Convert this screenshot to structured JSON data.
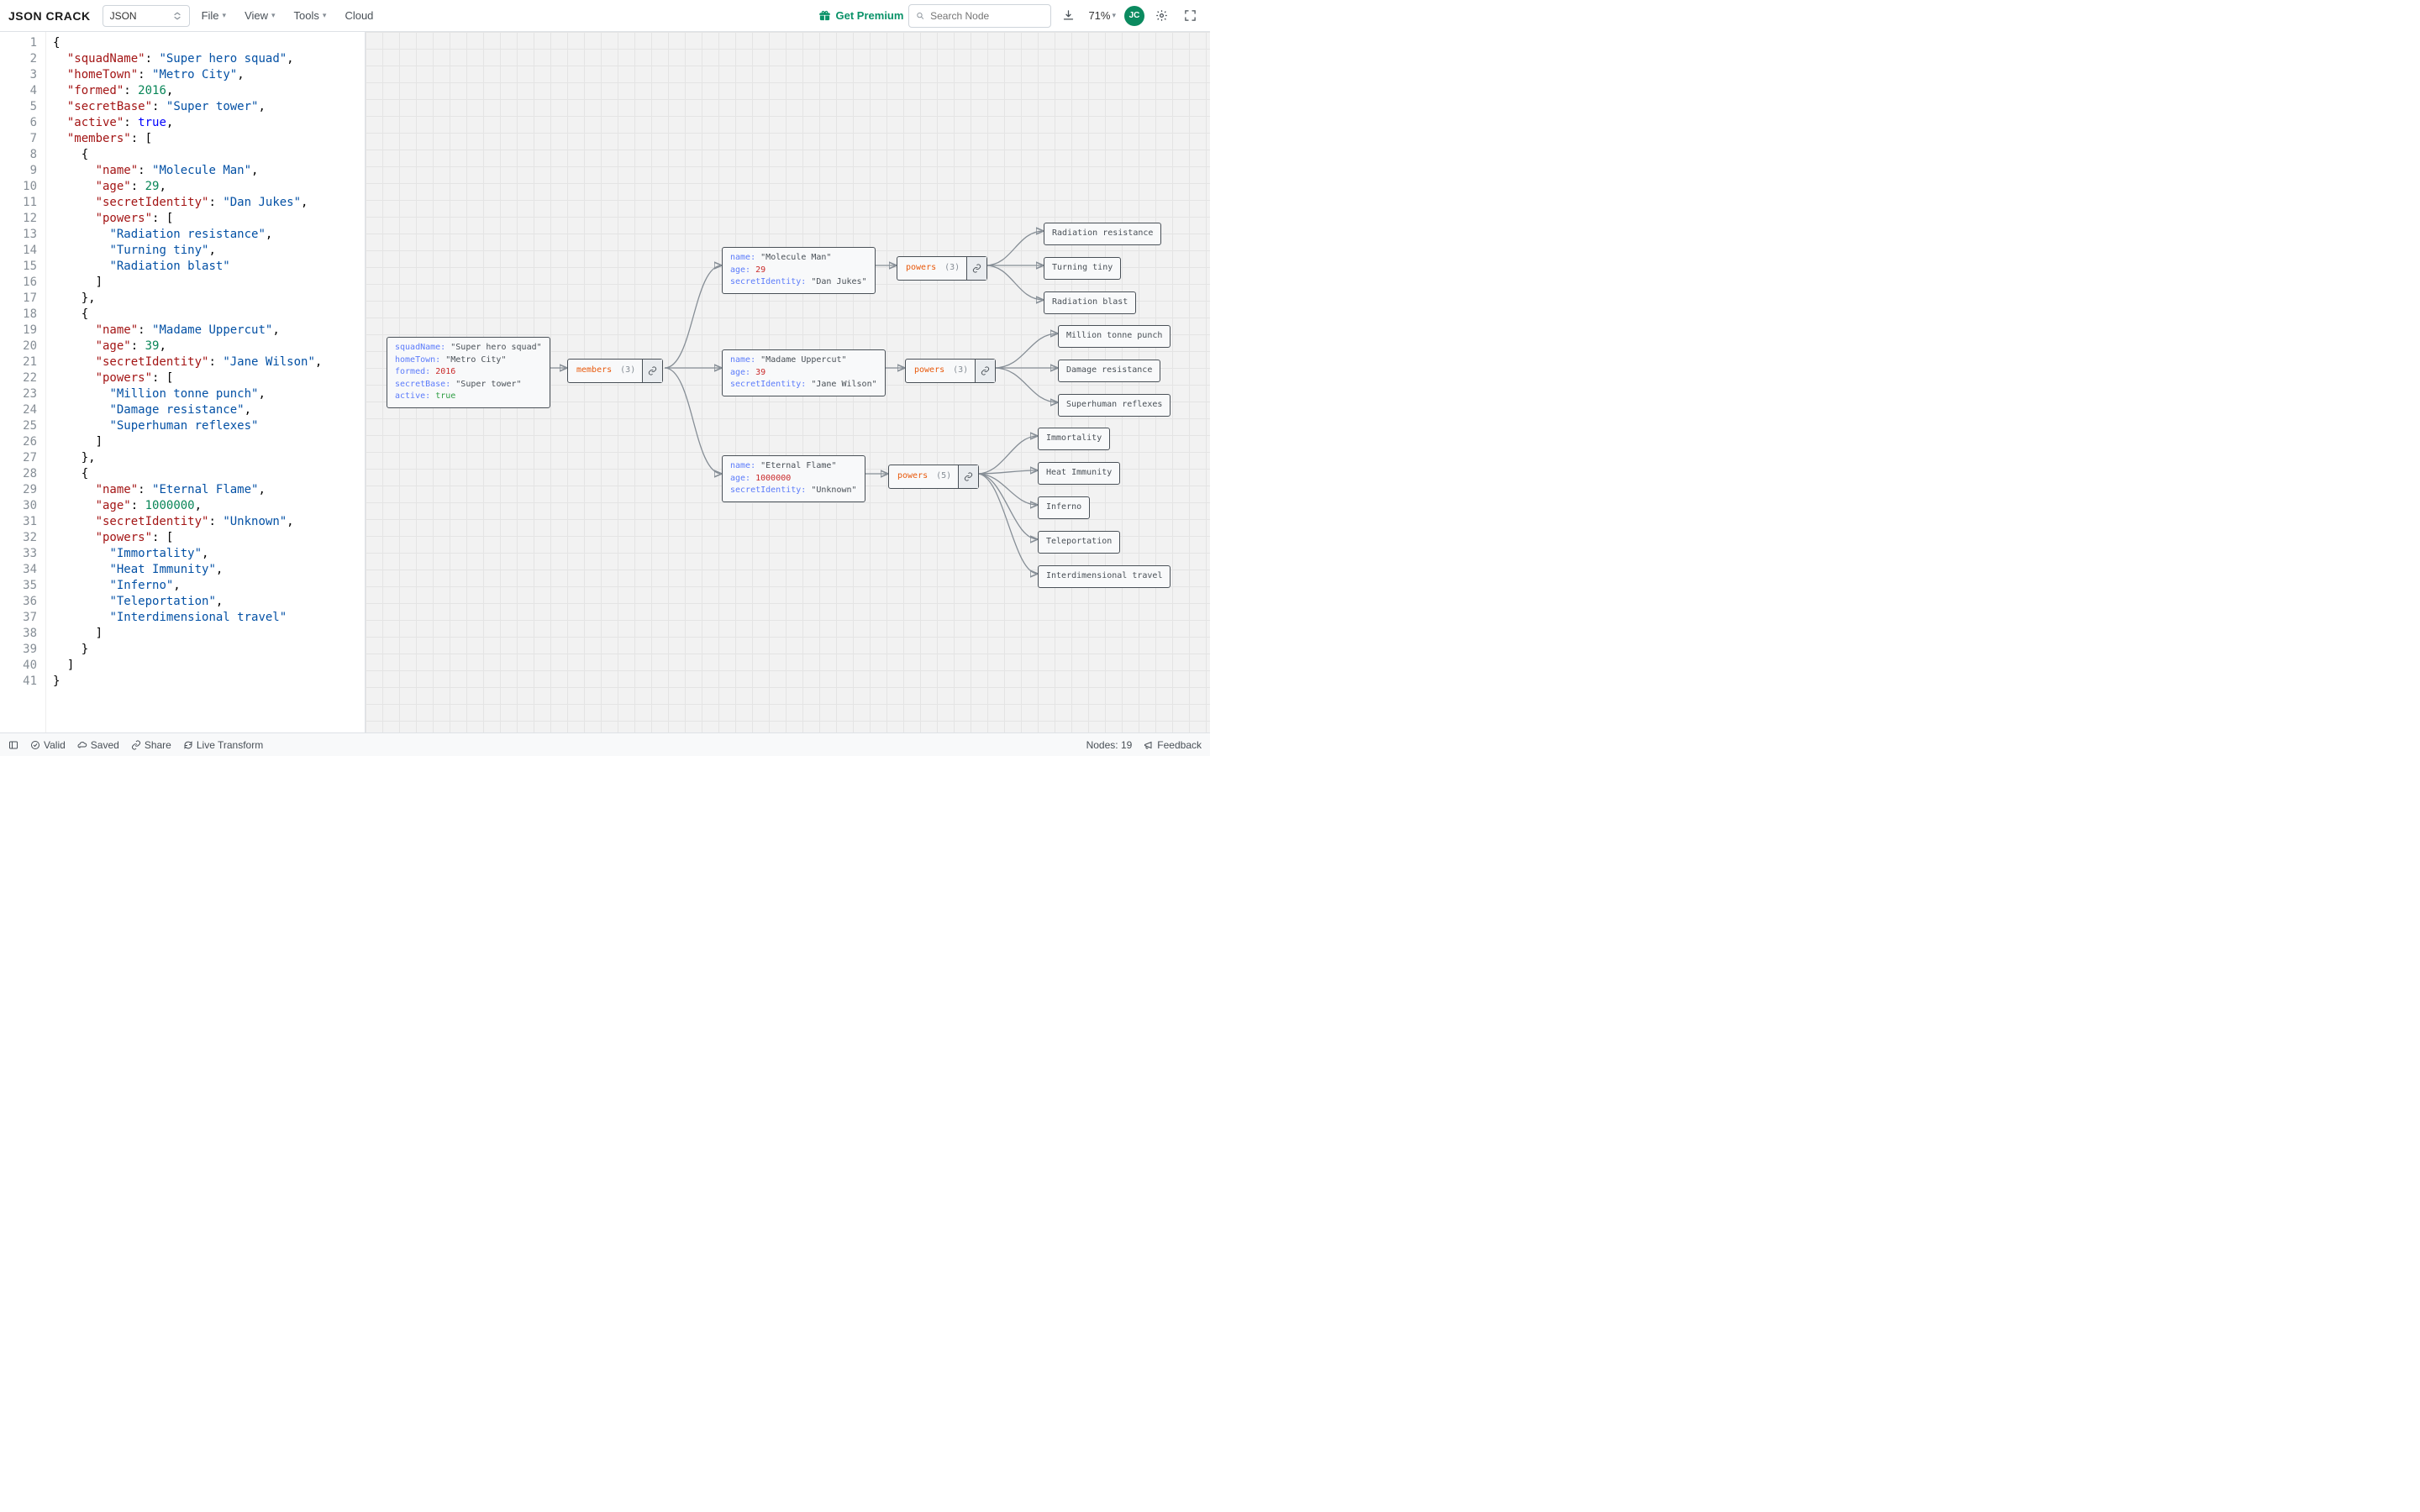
{
  "app": {
    "logo": "JSON CRACK",
    "format": "JSON"
  },
  "menu": {
    "file": "File",
    "view": "View",
    "tools": "Tools",
    "cloud": "Cloud"
  },
  "header": {
    "premium": "Get Premium",
    "search_placeholder": "Search Node",
    "zoom": "71%",
    "avatar": "JC"
  },
  "editor": {
    "line_count": 41,
    "json": {
      "squadName": "Super hero squad",
      "homeTown": "Metro City",
      "formed": 2016,
      "secretBase": "Super tower",
      "active": true,
      "members": [
        {
          "name": "Molecule Man",
          "age": 29,
          "secretIdentity": "Dan Jukes",
          "powers": [
            "Radiation resistance",
            "Turning tiny",
            "Radiation blast"
          ]
        },
        {
          "name": "Madame Uppercut",
          "age": 39,
          "secretIdentity": "Jane Wilson",
          "powers": [
            "Million tonne punch",
            "Damage resistance",
            "Superhuman reflexes"
          ]
        },
        {
          "name": "Eternal Flame",
          "age": 1000000,
          "secretIdentity": "Unknown",
          "powers": [
            "Immortality",
            "Heat Immunity",
            "Inferno",
            "Teleportation",
            "Interdimensional travel"
          ]
        }
      ]
    }
  },
  "graph": {
    "root": {
      "squadName": "Super hero squad",
      "homeTown": "Metro City",
      "formed": "2016",
      "secretBase": "Super tower",
      "active": "true"
    },
    "members_label": "members",
    "members_count": "(3)",
    "powers_label": "powers",
    "m0": {
      "name": "Molecule Man",
      "age": "29",
      "secretIdentity": "Dan Jukes",
      "powers_count": "(3)"
    },
    "m1": {
      "name": "Madame Uppercut",
      "age": "39",
      "secretIdentity": "Jane Wilson",
      "powers_count": "(3)"
    },
    "m2": {
      "name": "Eternal Flame",
      "age": "1000000",
      "secretIdentity": "Unknown",
      "powers_count": "(5)"
    },
    "leaves": {
      "p00": "Radiation resistance",
      "p01": "Turning tiny",
      "p02": "Radiation blast",
      "p10": "Million tonne punch",
      "p11": "Damage resistance",
      "p12": "Superhuman reflexes",
      "p20": "Immortality",
      "p21": "Heat Immunity",
      "p22": "Inferno",
      "p23": "Teleportation",
      "p24": "Interdimensional travel"
    }
  },
  "status": {
    "valid": "Valid",
    "saved": "Saved",
    "share": "Share",
    "live": "Live Transform",
    "nodes": "Nodes: 19",
    "feedback": "Feedback"
  }
}
